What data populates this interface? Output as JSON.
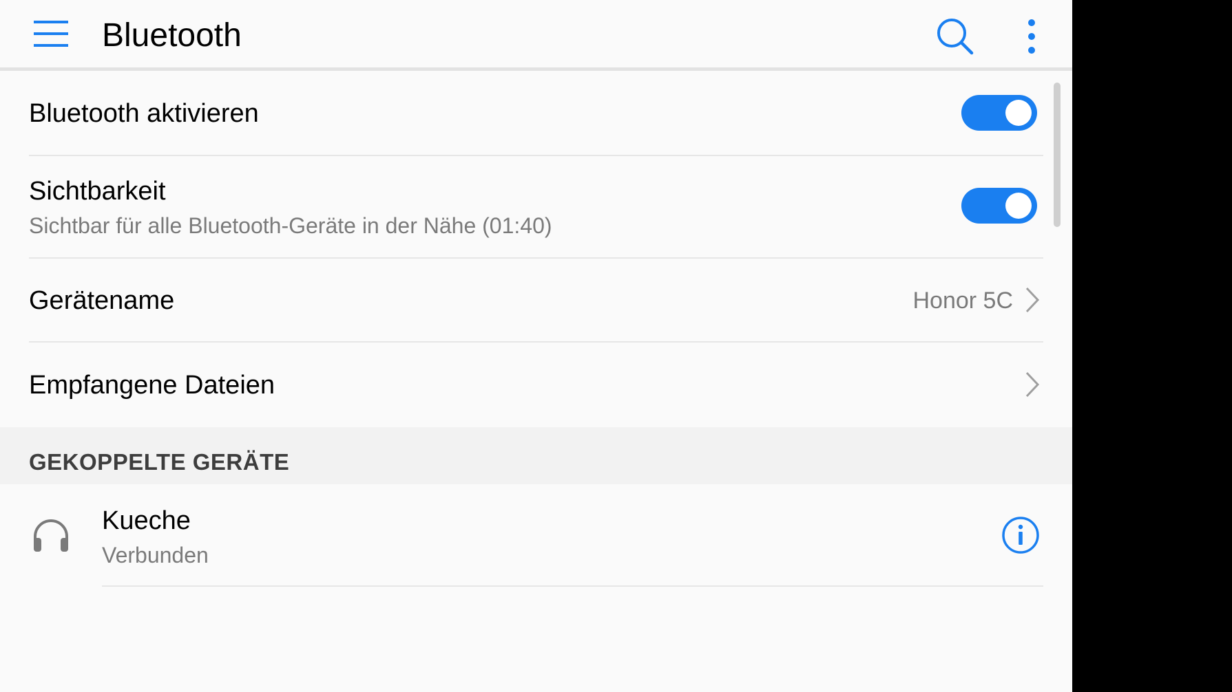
{
  "appbar": {
    "title": "Bluetooth",
    "menu_icon": "hamburger-menu-icon",
    "search_icon": "search-icon",
    "more_icon": "more-vertical-icon"
  },
  "settings": {
    "enable_bluetooth": {
      "label": "Bluetooth aktivieren",
      "enabled": true
    },
    "visibility": {
      "label": "Sichtbarkeit",
      "subtitle": "Sichtbar für alle Bluetooth-Geräte in der Nähe (01:40)",
      "enabled": true
    },
    "device_name": {
      "label": "Gerätename",
      "value": "Honor 5C"
    },
    "received_files": {
      "label": "Empfangene Dateien"
    }
  },
  "paired_section": {
    "header": "GEKOPPELTE GERÄTE",
    "devices": [
      {
        "name": "Kueche",
        "status": "Verbunden",
        "icon": "headphones-icon",
        "action_icon": "info-icon"
      }
    ]
  },
  "colors": {
    "accent": "#1a7ff0",
    "background": "#fafafa",
    "section_background": "#f2f2f2",
    "secondary_text": "#7a7a7a"
  }
}
